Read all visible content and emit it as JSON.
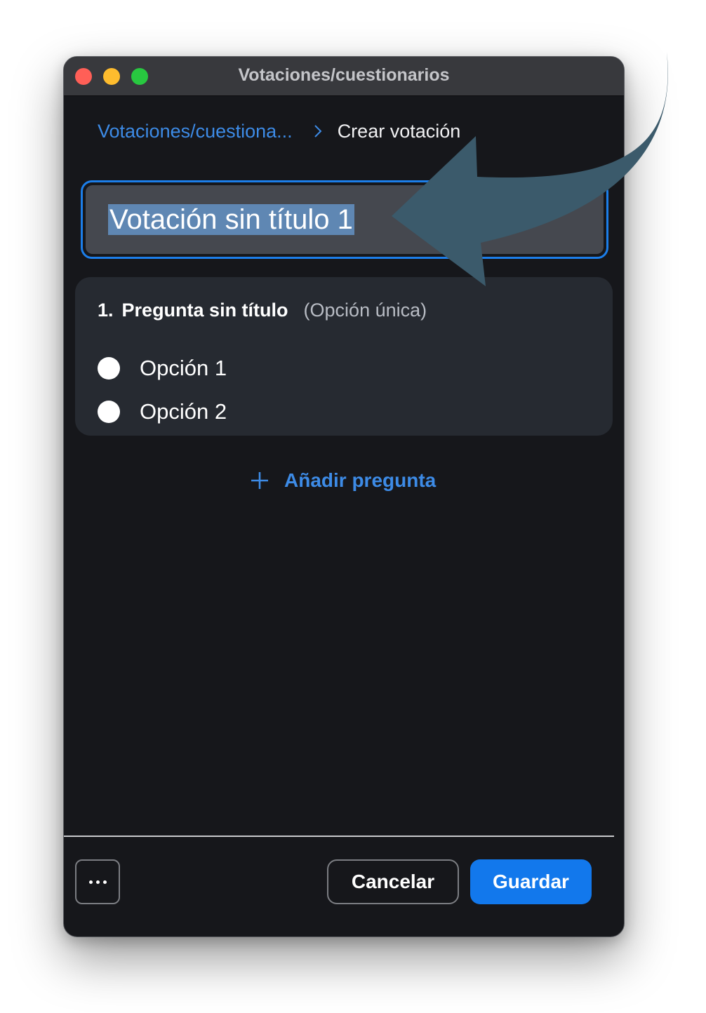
{
  "window": {
    "title": "Votaciones/cuestionarios"
  },
  "breadcrumb": {
    "parent": "Votaciones/cuestiona...",
    "current": "Crear votación"
  },
  "poll": {
    "title_value": "Votación sin título 1"
  },
  "question": {
    "number": "1.",
    "title": "Pregunta sin título",
    "type": "(Opción única)",
    "options": [
      "Opción 1",
      "Opción 2"
    ]
  },
  "actions": {
    "add_question": "Añadir pregunta",
    "cancel": "Cancelar",
    "save": "Guardar"
  },
  "colors": {
    "accent": "#1278ec",
    "link": "#3d8be6",
    "annotation_arrow": "#3b5a6b"
  }
}
